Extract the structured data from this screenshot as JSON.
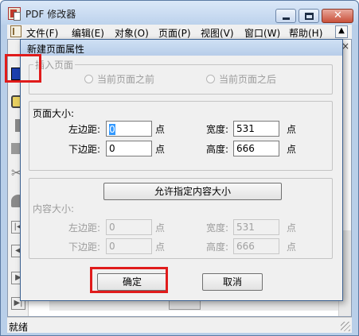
{
  "window": {
    "title": "PDF 修改器",
    "controls": {
      "minimize": "minimize",
      "maximize": "maximize",
      "close": "close"
    }
  },
  "menubar": {
    "items": [
      "文件(F)",
      "编辑(E)",
      "对象(O)",
      "页面(P)",
      "视图(V)",
      "窗口(W)",
      "帮助(H)"
    ],
    "expander": "▲"
  },
  "doc": {
    "close": "×"
  },
  "statusbar": {
    "text": "就绪"
  },
  "dialog": {
    "title": "新建页面属性",
    "insert_group": {
      "legend": "插入页面",
      "options": [
        "当前页面之前",
        "当前页面之后"
      ]
    },
    "page_size": {
      "legend": "页面大小:",
      "left_margin_label": "左边距:",
      "left_margin_value": "0",
      "bottom_margin_label": "下边距:",
      "bottom_margin_value": "0",
      "width_label": "宽度:",
      "width_value": "531",
      "height_label": "高度:",
      "height_value": "666",
      "unit": "点"
    },
    "allow_button": "允许指定内容大小",
    "content_size": {
      "legend": "内容大小:",
      "left_margin_label": "左边距:",
      "left_margin_value": "0",
      "bottom_margin_label": "下边距:",
      "bottom_margin_value": "0",
      "width_label": "宽度:",
      "width_value": "531",
      "height_label": "高度:",
      "height_value": "666",
      "unit": "点"
    },
    "ok_button": "确定",
    "cancel_button": "取消"
  },
  "colors": {
    "highlight": "#e01b1b",
    "titlebar": "#bcd2ec"
  }
}
